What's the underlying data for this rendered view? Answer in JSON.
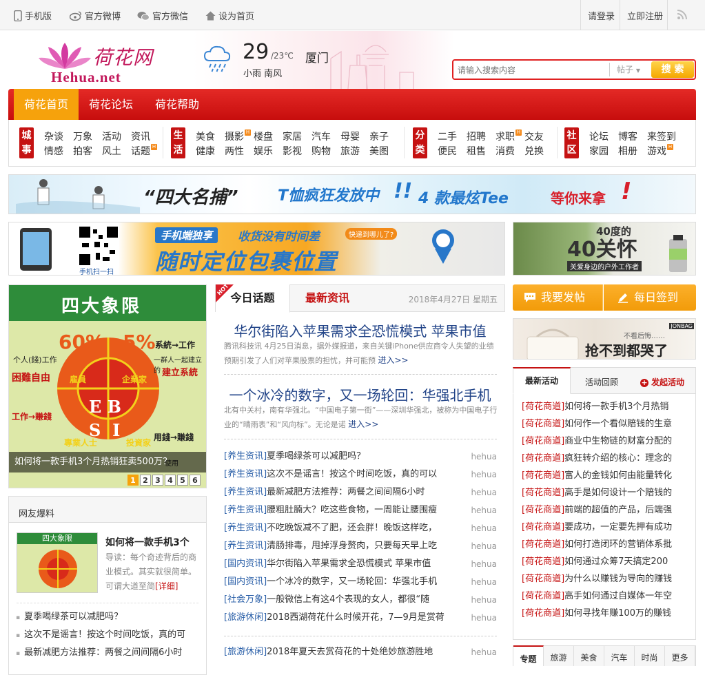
{
  "topbar": {
    "mobile": "手机版",
    "weibo": "官方微博",
    "weixin": "官方微信",
    "homepage": "设为首页",
    "login": "请登录",
    "register": "立即注册"
  },
  "logo": {
    "cn": "荷花网",
    "en": "Hehua.net"
  },
  "weather": {
    "temp": "29",
    "range": "/23℃",
    "city": "厦门",
    "desc": "小雨 南风"
  },
  "search": {
    "placeholder": "请输入搜索内容",
    "select": "帖子",
    "button": "搜 索"
  },
  "nav": [
    "荷花首页",
    "荷花论坛",
    "荷花帮助"
  ],
  "subnav": {
    "city": {
      "c1": "城",
      "c2": "事",
      "items": [
        "杂谈",
        "万象",
        "活动",
        "资讯",
        "情感",
        "拍客",
        "风土",
        "话题"
      ]
    },
    "life": {
      "c1": "生",
      "c2": "活",
      "items": [
        "美食",
        "摄影",
        "楼盘",
        "家居",
        "汽车",
        "母婴",
        "亲子",
        "健康",
        "两性",
        "娱乐",
        "影视",
        "购物",
        "旅游",
        "美图"
      ]
    },
    "cls": {
      "c1": "分",
      "c2": "类",
      "items": [
        "二手",
        "招聘",
        "求职",
        "交友",
        "便民",
        "租售",
        "消费",
        "兑换"
      ]
    },
    "comm": {
      "c1": "社",
      "c2": "区",
      "items": [
        "论坛",
        "博客",
        "来签到",
        "家园",
        "相册",
        "游戏"
      ]
    },
    "hot": "H"
  },
  "banners": {
    "tee": {
      "t1": "“四大名捕”",
      "t2": "T恤疯狂发放中",
      "t3": "!!",
      "t4": "4 款最炫Tee",
      "t5": "等你来拿",
      "t6": "!"
    },
    "pkg": {
      "t1": "手机端独享",
      "t2": "收货没有时间差",
      "t3": "快递到哪儿了?",
      "t4": "随时定位包裹位置",
      "t5": "手机扫一扫"
    },
    "care": {
      "t1": "40度的",
      "t2": "关怀",
      "t3": "关爱身边的户外工作者"
    }
  },
  "slider": {
    "title": "四大象限",
    "caption": "如何将一款手机3个月热销狂卖500万？",
    "pages": [
      "1",
      "2",
      "3",
      "4",
      "5",
      "6"
    ],
    "labels": {
      "e": "E",
      "b": "B",
      "s": "S",
      "i": "I",
      "p60": "60%",
      "p5": "5%",
      "l1": "个人(錢)工作",
      "l2": "系統→工作",
      "l3": "一群人一起建立的",
      "l4": "建立系統",
      "l5": "困難自由",
      "l6": "雇員",
      "l7": "企業家",
      "l8": "專業人士",
      "l9": "投資家",
      "l10": "用錢→賺錢",
      "l11": "工作→賺錢",
      "l12": "使用"
    }
  },
  "netfriend": {
    "title": "网友爆料",
    "headline": "如何将一款手机3个",
    "desc": "导读：每个奇迹背后的商业模式。其实就很简单。可谓大道至简",
    "detail": "[详细]",
    "thumb": "四大象限",
    "items": [
      "夏季喝绿茶可以减肥吗？",
      "这次不是谣言！按这个时间吃饭，真的可",
      "最新减肥方法推荐：两餐之间间隔6小时"
    ]
  },
  "center": {
    "tab1": "今日话题",
    "tab2": "最新资讯",
    "date": "2018年4月27日 星期五",
    "hot": "HOT",
    "h1": "华尔街陷入苹果需求全恐慌模式 苹果市值",
    "s1": "腾讯科技讯 4月25日消息，据外媒报道，来自关键iPhone供应商令人失望的业绩预期引发了人们对苹果股票的担忧，并可能预",
    "more1": "进入>>",
    "h2": "一个冰冷的数字，又一场轮回：华强北手机",
    "s2": "北有中关村，南有华强北。“中国电子第一街”——深圳华强北，被称为中国电子行业的“晴雨表”和“风向标”。无论是诺",
    "more2": "进入>>",
    "list": [
      {
        "tag": "[养生资讯]",
        "t": "夏季喝绿茶可以减肥吗？",
        "a": "hehua"
      },
      {
        "tag": "[养生资讯]",
        "t": "这次不是谣言！按这个时间吃饭，真的可以",
        "a": "hehua"
      },
      {
        "tag": "[养生资讯]",
        "t": "最新减肥方法推荐：两餐之间间隔6小时",
        "a": "hehua"
      },
      {
        "tag": "[养生资讯]",
        "t": "腰粗肚腩大？吃这些食物，一周能让腰围瘦",
        "a": "hehua"
      },
      {
        "tag": "[养生资讯]",
        "t": "不吃晚饭减不了肥，还会胖！晚饭这样吃，",
        "a": "hehua"
      },
      {
        "tag": "[养生资讯]",
        "t": "清肠排毒，甩掉浮身赘肉，只要每天早上吃",
        "a": "hehua"
      },
      {
        "tag": "[国内资讯]",
        "t": "华尔街陷入苹果需求全恐慌模式 苹果市值",
        "a": "hehua"
      },
      {
        "tag": "[国内资讯]",
        "t": "一个冰冷的数字，又一场轮回：华强北手机",
        "a": "hehua"
      },
      {
        "tag": "[社会万象]",
        "t": "一般微信上有这4个表现的女人，都很“随",
        "a": "hehua"
      },
      {
        "tag": "[旅游休闲]",
        "t": "2018西湖荷花什么时候开花，7—9月是赏荷",
        "a": "hehua"
      }
    ],
    "last": {
      "tag": "[旅游休闲]",
      "t": "2018年夏天去赏荷花的十处绝妙旅游胜地",
      "a": "hehua"
    }
  },
  "right": {
    "post": "我要发帖",
    "sign": "每日签到",
    "ad": {
      "brand": "JONBAG",
      "t1": "不看后悔……",
      "t2": "抢不到都哭了"
    },
    "tab1": "最新活动",
    "tab2": "活动回顾",
    "tab3": "发起活动",
    "list": [
      {
        "tag": "[荷花商道]",
        "t": "如何将一款手机3个月热销"
      },
      {
        "tag": "[荷花商道]",
        "t": "如何作一个看似赔钱的生意"
      },
      {
        "tag": "[荷花商道]",
        "t": "商业中生物链的财富分配的"
      },
      {
        "tag": "[荷花商道]",
        "t": "疯狂转介绍的核心：理念的"
      },
      {
        "tag": "[荷花商道]",
        "t": "富人的金钱如何由能量转化"
      },
      {
        "tag": "[荷花商道]",
        "t": "高手是如何设计一个赔钱的"
      },
      {
        "tag": "[荷花商道]",
        "t": "前端的超值的产品，后端强"
      },
      {
        "tag": "[荷花商道]",
        "t": "要成功，一定要先押有成功"
      },
      {
        "tag": "[荷花商道]",
        "t": "如何打造闭环的营销体系批"
      },
      {
        "tag": "[荷花商道]",
        "t": "如何通过众筹7天搞定200"
      },
      {
        "tag": "[荷花商道]",
        "t": "为什么以赚钱为导向的赚钱"
      },
      {
        "tag": "[荷花商道]",
        "t": "高手如何通过自媒体一年空"
      },
      {
        "tag": "[荷花商道]",
        "t": "如何寻找年赚100万的赚钱"
      }
    ],
    "bottabs": [
      "专题",
      "旅游",
      "美食",
      "汽车",
      "时尚",
      "更多"
    ]
  }
}
